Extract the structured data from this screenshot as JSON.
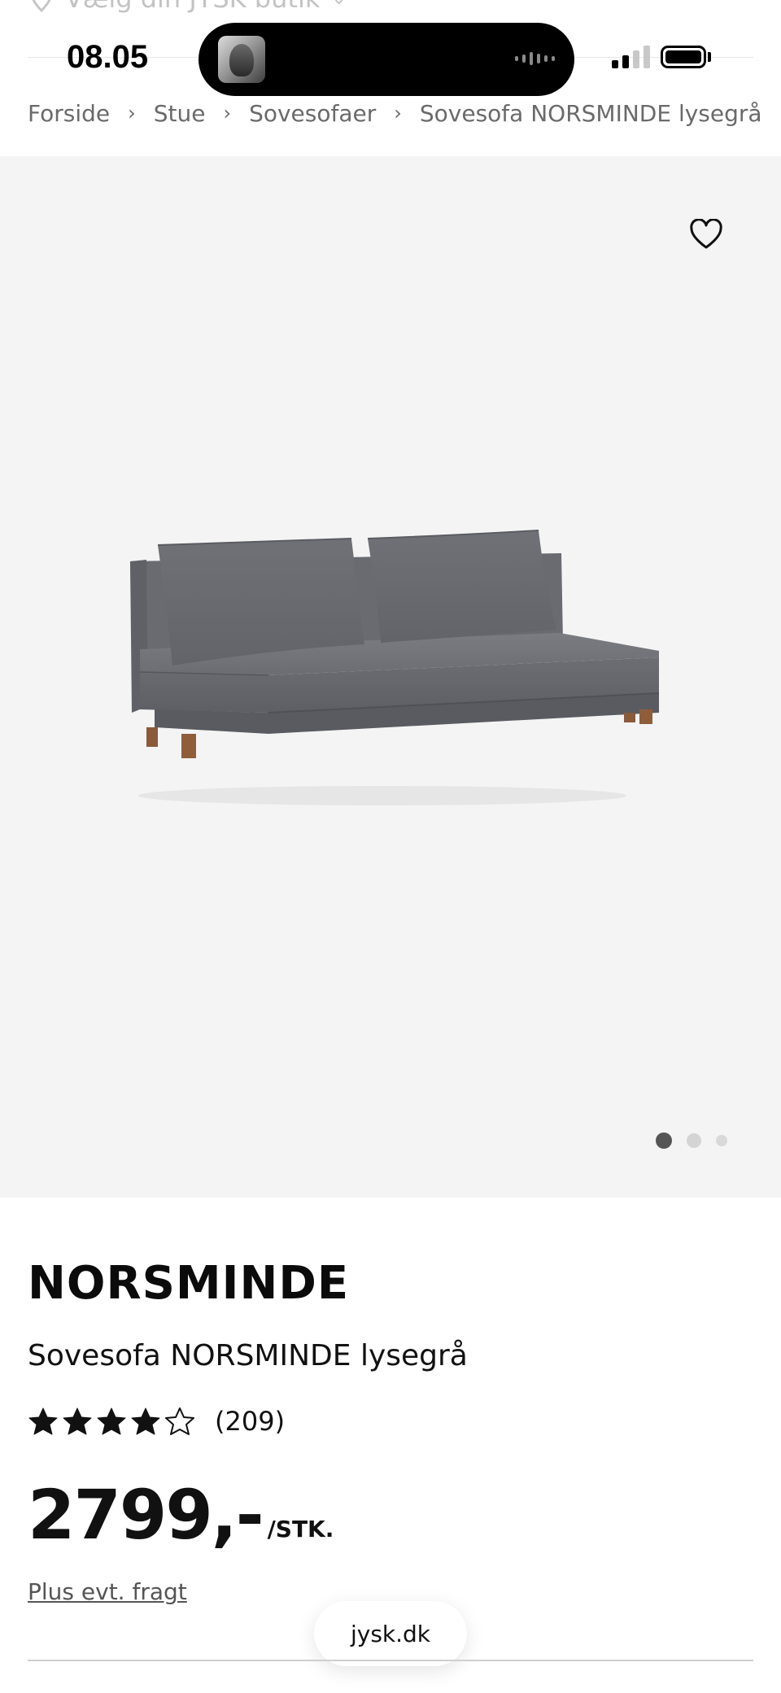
{
  "header": {
    "store_picker_label": "Vælg din JYSK butik"
  },
  "status_bar": {
    "time": "08.05"
  },
  "breadcrumb": [
    {
      "label": "Forside"
    },
    {
      "label": "Stue"
    },
    {
      "label": "Sovesofaer"
    },
    {
      "label": "Sovesofa NORSMINDE lysegrå"
    }
  ],
  "gallery": {
    "image_count": 3,
    "active_index": 0,
    "favorite_icon": "heart-outline-icon"
  },
  "product": {
    "brand": "NORSMINDE",
    "name": "Sovesofa NORSMINDE lysegrå",
    "rating": 4,
    "rating_max": 5,
    "review_count": "(209)",
    "price": "2799,-",
    "price_unit": "/STK.",
    "freight_note": "Plus evt. fragt"
  },
  "browser": {
    "url": "jysk.dk"
  },
  "colors": {
    "hero_background": "#f4f4f4",
    "sofa_fabric": "#6d6f75",
    "text": "#111111",
    "muted_text": "#6a6a6a"
  }
}
